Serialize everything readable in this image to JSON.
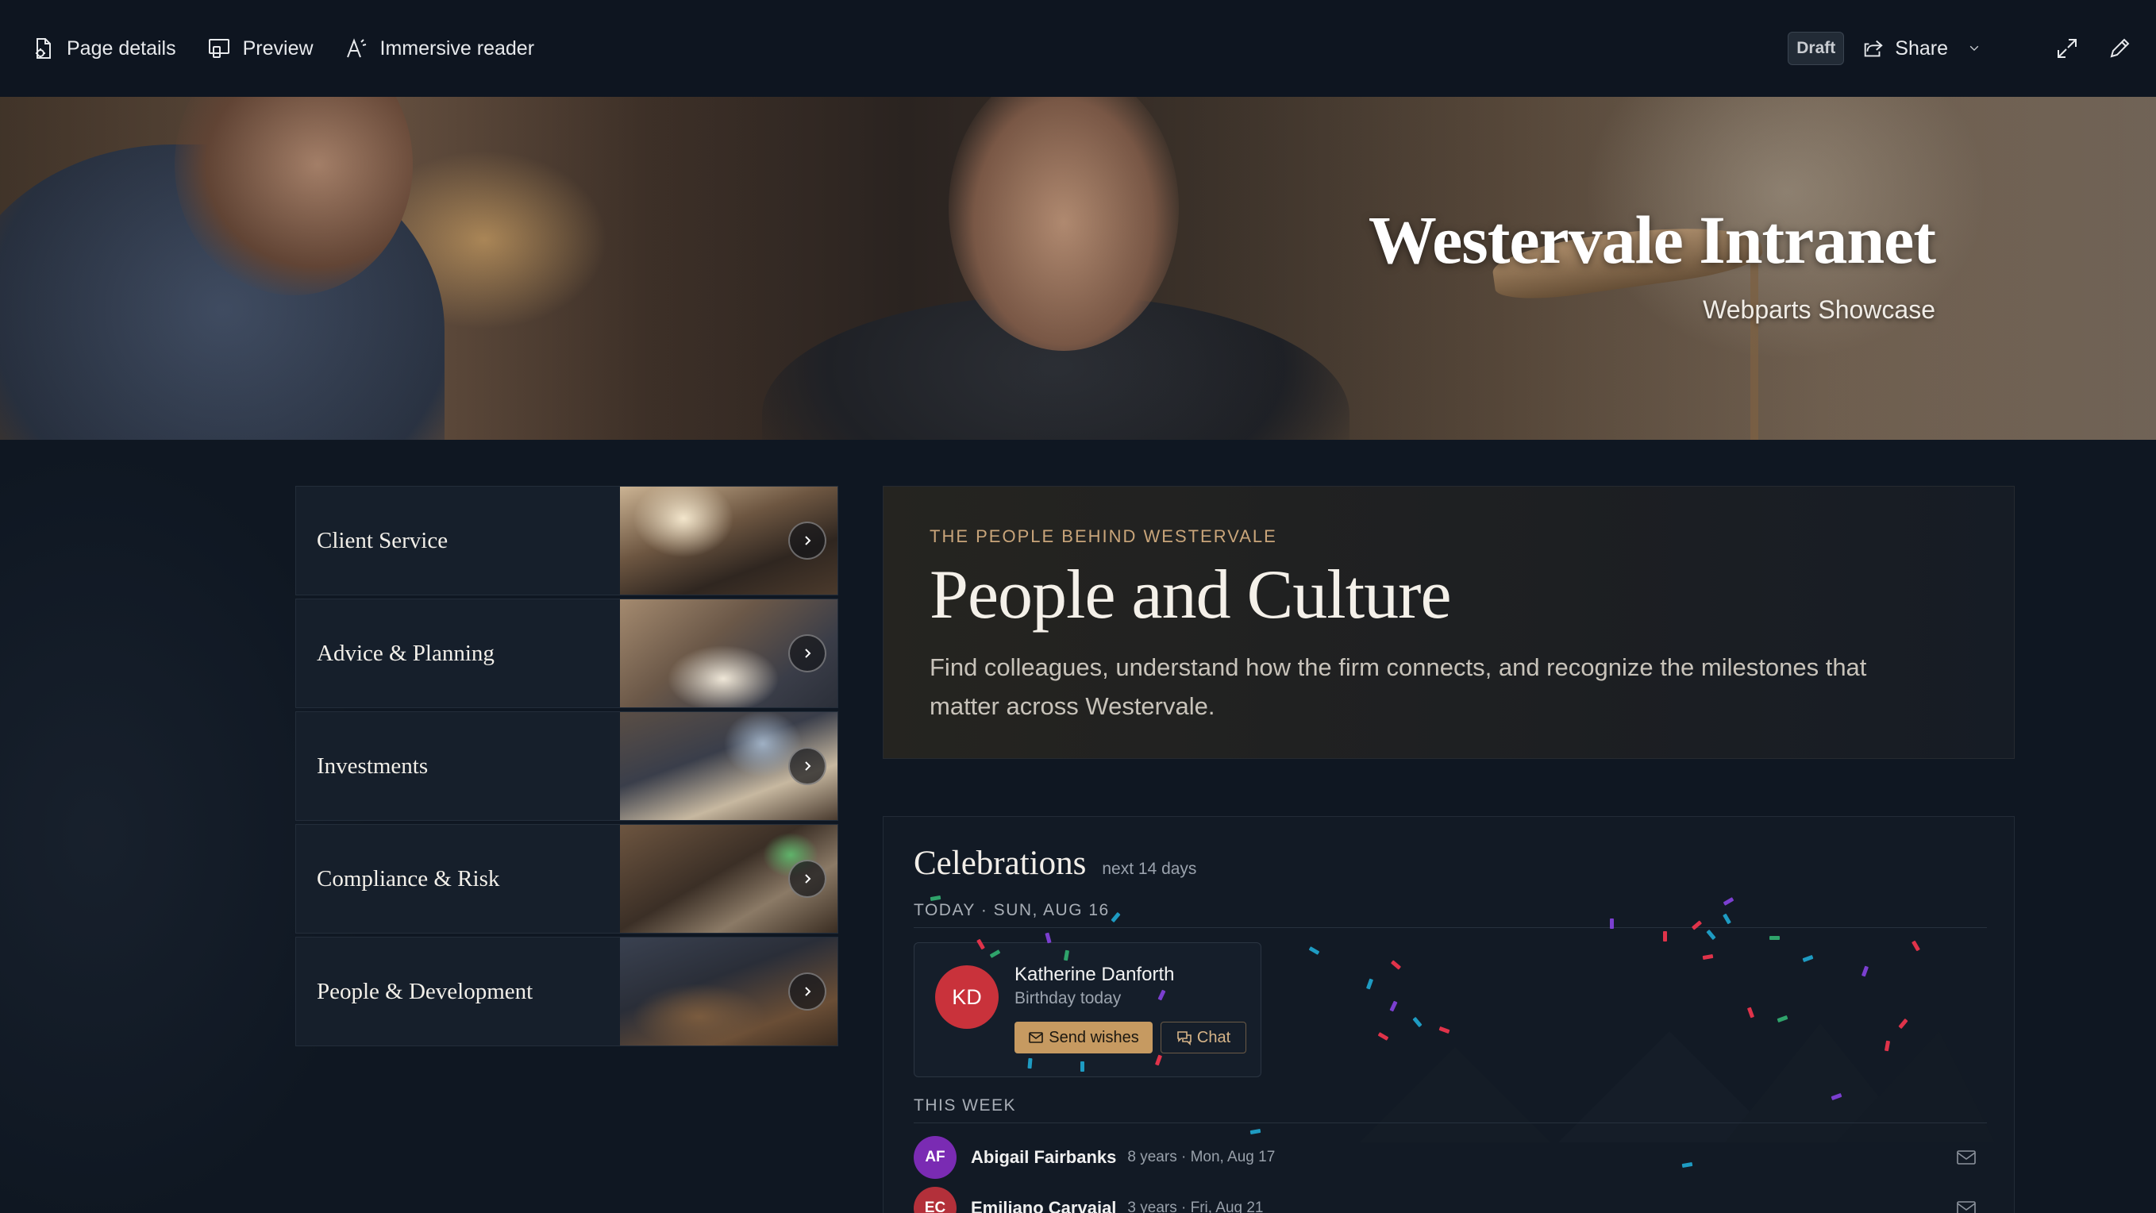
{
  "command_bar": {
    "page_details": "Page details",
    "preview": "Preview",
    "immersive_reader": "Immersive reader",
    "draft_badge": "Draft",
    "share": "Share"
  },
  "hero": {
    "title": "Westervale Intranet",
    "subtitle": "Webparts Showcase"
  },
  "quick_links": [
    {
      "label": "Client Service"
    },
    {
      "label": "Advice & Planning"
    },
    {
      "label": "Investments"
    },
    {
      "label": "Compliance & Risk"
    },
    {
      "label": "People & Development"
    }
  ],
  "people_culture": {
    "eyebrow": "THE PEOPLE BEHIND WESTERVALE",
    "title": "People and Culture",
    "description": "Find colleagues, understand how the firm connects, and recognize the milestones that matter across Westervale."
  },
  "celebrations": {
    "title": "Celebrations",
    "range": "next 14 days",
    "today_label": "TODAY · SUN, AUG 16",
    "today_card": {
      "initials": "KD",
      "name": "Katherine Danforth",
      "subtitle": "Birthday today",
      "send_wishes": "Send wishes",
      "chat": "Chat",
      "avatar_color": "#c9323b"
    },
    "week_label": "THIS WEEK",
    "week": [
      {
        "initials": "AF",
        "name": "Abigail Fairbanks",
        "meta": "8 years · Mon, Aug 17",
        "avatar_color": "#7a2bb3"
      },
      {
        "initials": "EC",
        "name": "Emiliano Carvajal",
        "meta": "3 years · Fri, Aug 21",
        "avatar_color": "#b3303a"
      }
    ]
  },
  "colors": {
    "accent_gold": "#c69a61",
    "background": "#0f1722",
    "eyebrow": "#c9a57a"
  }
}
